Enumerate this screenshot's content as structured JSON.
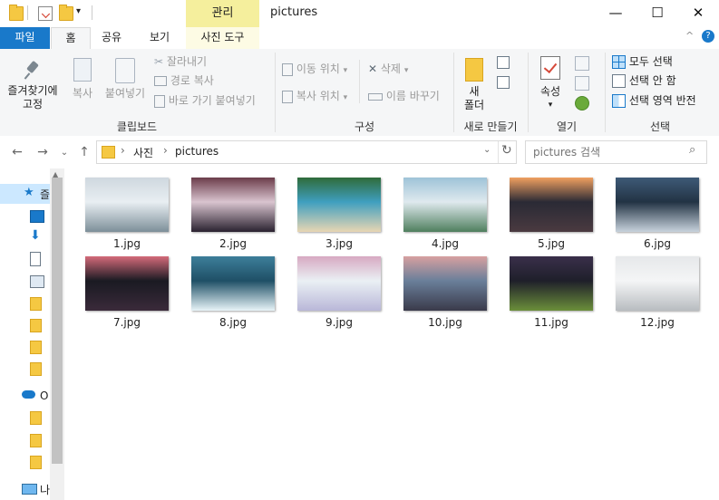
{
  "window": {
    "title": "pictures",
    "manage_tab": "관리",
    "minimize": "—",
    "maximize": "☐",
    "close": "✕"
  },
  "ribbon": {
    "tabs": {
      "file": "파일",
      "home": "홈",
      "share": "공유",
      "view": "보기",
      "picture_tools": "사진 도구"
    },
    "help": "?",
    "collapse": "^",
    "clipboard": {
      "label": "클립보드",
      "pin_line1": "즐겨찾기에",
      "pin_line2": "고정",
      "copy": "복사",
      "paste": "붙여넣기",
      "cut": "잘라내기",
      "copy_path": "경로 복사",
      "paste_shortcut": "바로 가기 붙여넣기"
    },
    "organize": {
      "label": "구성",
      "move_to": "이동 위치",
      "copy_to": "복사 위치",
      "delete": "삭제",
      "rename": "이름 바꾸기"
    },
    "new": {
      "label": "새로 만들기",
      "new_folder_line1": "새",
      "new_folder_line2": "폴더"
    },
    "open": {
      "label": "열기",
      "properties": "속성"
    },
    "select": {
      "label": "선택",
      "select_all": "모두 선택",
      "select_none": "선택 안 함",
      "invert": "선택 영역 반전"
    }
  },
  "address": {
    "path": [
      "사진",
      "pictures"
    ],
    "separator": "›",
    "search_placeholder": "pictures 검색"
  },
  "nav": {
    "quick_access_label": "즐",
    "onedrive_label": "O",
    "pc_label": "나"
  },
  "files": [
    {
      "name": "1.jpg",
      "colors": [
        "#cfd8df",
        "#7d8f99",
        "#e8eef2"
      ]
    },
    {
      "name": "2.jpg",
      "colors": [
        "#6b3c4a",
        "#2a2230",
        "#d9c4cf"
      ]
    },
    {
      "name": "3.jpg",
      "colors": [
        "#2f6b3a",
        "#e8d6b3",
        "#3f9fbf"
      ]
    },
    {
      "name": "4.jpg",
      "colors": [
        "#9ec3d8",
        "#4f7f5e",
        "#dfe9ee"
      ]
    },
    {
      "name": "5.jpg",
      "colors": [
        "#f0a060",
        "#4a3a40",
        "#2a2a35"
      ]
    },
    {
      "name": "6.jpg",
      "colors": [
        "#3e5a77",
        "#c7d2dc",
        "#223344"
      ]
    },
    {
      "name": "7.jpg",
      "colors": [
        "#d46a7a",
        "#3a2a3a",
        "#1a1a22"
      ]
    },
    {
      "name": "8.jpg",
      "colors": [
        "#3d7f9a",
        "#e8f4f8",
        "#1f4f66"
      ]
    },
    {
      "name": "9.jpg",
      "colors": [
        "#d7a9c2",
        "#b9b7d8",
        "#eaf0f4"
      ]
    },
    {
      "name": "10.jpg",
      "colors": [
        "#d7a0a0",
        "#3a3a4a",
        "#6a7f9a"
      ]
    },
    {
      "name": "11.jpg",
      "colors": [
        "#3a2f4a",
        "#6b8f3a",
        "#1f1f2a"
      ]
    },
    {
      "name": "12.jpg",
      "colors": [
        "#e6e8ea",
        "#b8bcc0",
        "#f4f5f6"
      ]
    }
  ],
  "colors": {
    "file_tab": "#1979ca",
    "manage_tab": "#f5ef9d",
    "accent": "#1979ca"
  }
}
